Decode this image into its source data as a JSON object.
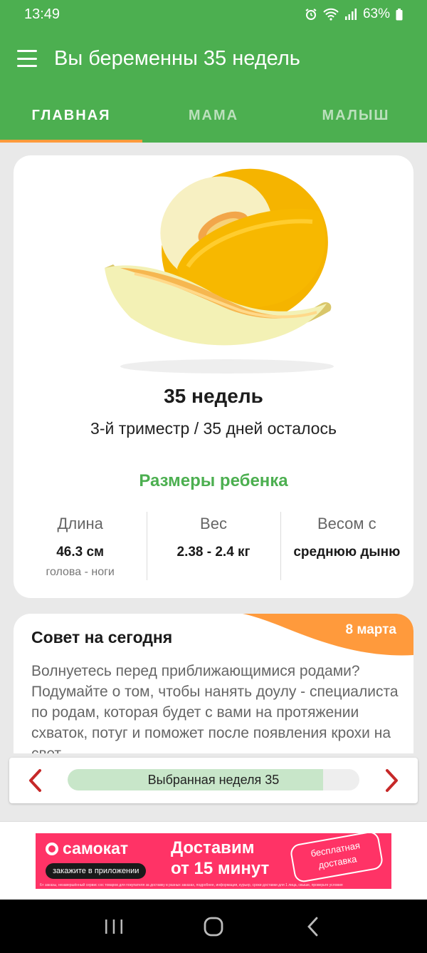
{
  "status_bar": {
    "time": "13:49",
    "battery": "63%"
  },
  "app_bar": {
    "title": "Вы беременны 35 недель"
  },
  "tabs": [
    {
      "label": "ГЛАВНАЯ",
      "active": true
    },
    {
      "label": "МАМА",
      "active": false
    },
    {
      "label": "МАЛЫШ",
      "active": false
    }
  ],
  "week_card": {
    "fruit_icon": "honeydew-melon",
    "title": "35 недель",
    "subtitle": "3-й триместр / 35 дней осталось",
    "sizes_heading": "Размеры ребенка",
    "stats": [
      {
        "label": "Длина",
        "value": "46.3 см",
        "sub": "голова - ноги"
      },
      {
        "label": "Вес",
        "value": "2.38 - 2.4 кг",
        "sub": ""
      },
      {
        "label": "Весом с",
        "value": "среднюю дыню",
        "sub": ""
      }
    ]
  },
  "tip": {
    "title": "Совет на сегодня",
    "date": "8 марта",
    "text": "Волнуетесь перед приближающимися родами? Подумайте о том, чтобы нанять доулу - специалиста по родам, которая будет с вами на протяжении схваток, потуг и поможет после появления крохи на свет."
  },
  "week_selector": {
    "label": "Выбранная неделя 35",
    "progress_fraction": 0.875
  },
  "ad": {
    "brand": "самокат",
    "pill": "закажите в приложении",
    "headline_line1": "Доставим",
    "headline_line2": "от 15 минут",
    "stamp": "бесплатная доставка",
    "fine_print": "6+ заказы, незавершённый сервис сос товаров для покупателя за доставку в разных заказах, подробнее, информация, курьер, сроки доставки для 1 лица, свыше, проверьте условия"
  },
  "colors": {
    "primary": "#4caf50",
    "accent": "#ff9a3c",
    "arrow": "#c62828",
    "ad_bg": "#ff3366"
  }
}
